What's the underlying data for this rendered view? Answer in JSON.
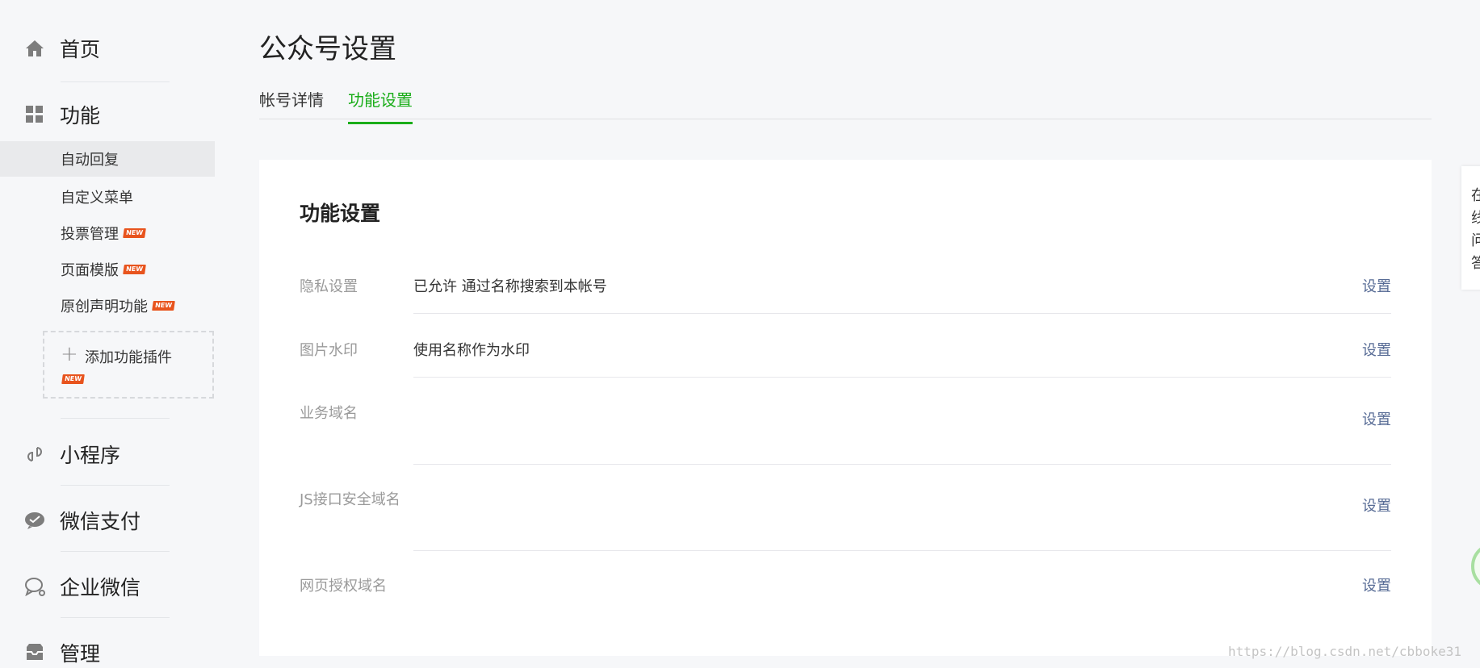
{
  "sidebar": {
    "home": {
      "label": "首页",
      "icon": "home-icon"
    },
    "features": {
      "label": "功能",
      "icon": "grid-icon",
      "items": [
        {
          "label": "自动回复",
          "active": true,
          "new": false
        },
        {
          "label": "自定义菜单",
          "new": false
        },
        {
          "label": "投票管理",
          "new": true
        },
        {
          "label": "页面模版",
          "new": true
        },
        {
          "label": "原创声明功能",
          "new": true
        }
      ],
      "add_plugin_label": "添加功能插件"
    },
    "miniprogram": {
      "label": "小程序",
      "icon": "link-icon"
    },
    "wechat_pay": {
      "label": "微信支付",
      "icon": "wechat-pay-icon"
    },
    "enterprise_wechat": {
      "label": "企业微信",
      "icon": "chat-bubble-icon"
    },
    "manage": {
      "label": "管理",
      "icon": "inbox-icon"
    },
    "new_badge": "NEW"
  },
  "page": {
    "title": "公众号设置",
    "tabs": [
      {
        "label": "帐号详情",
        "active": false
      },
      {
        "label": "功能设置",
        "active": true
      }
    ]
  },
  "card": {
    "title": "功能设置",
    "rows": [
      {
        "label": "隐私设置",
        "value": "已允许 通过名称搜索到本帐号",
        "action": "设置"
      },
      {
        "label": "图片水印",
        "value": "使用名称作为水印",
        "action": "设置"
      },
      {
        "label": "业务域名",
        "value": "",
        "action": "设置"
      },
      {
        "label": "JS接口安全域名",
        "value": "",
        "action": "设置"
      },
      {
        "label": "网页授权域名",
        "value": "",
        "action": "设置"
      }
    ]
  },
  "float_panel": {
    "chars": [
      "在",
      "线",
      "问",
      "答"
    ]
  },
  "watermark": "https://blog.csdn.net/cbboke31",
  "colors": {
    "accent_green": "#1aad19",
    "link_blue": "#576b95",
    "new_badge": "#e8541e",
    "background": "#f6f7f9"
  }
}
